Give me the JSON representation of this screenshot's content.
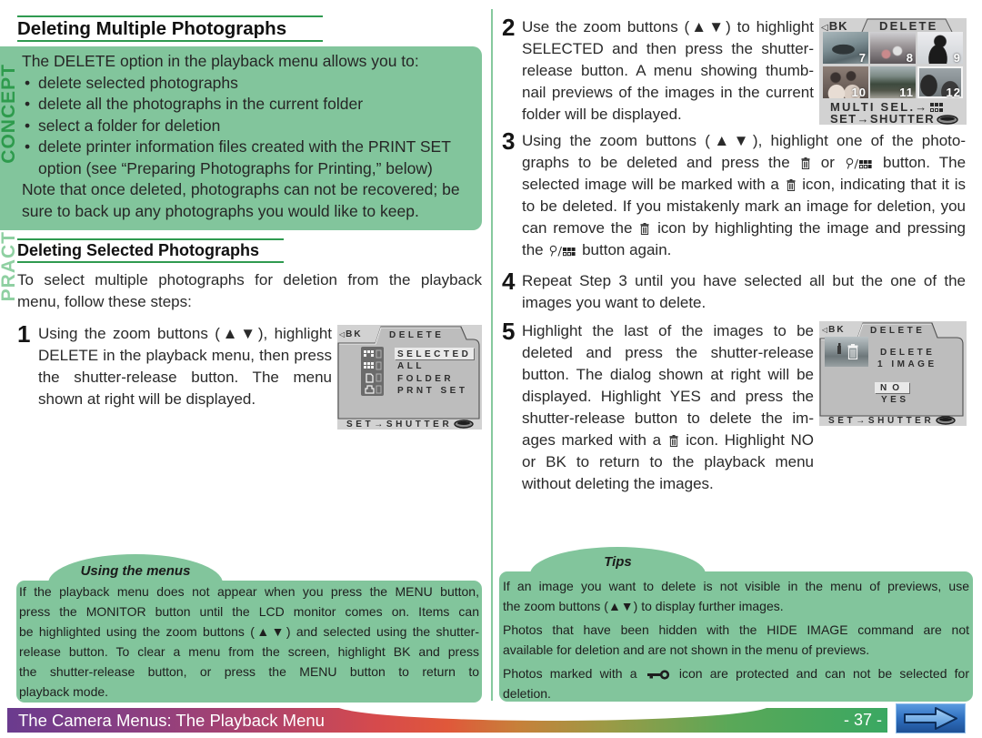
{
  "colors": {
    "accent": "#2f9a50",
    "callout_bg": "#82c59c",
    "label_concept": "#2e9b4d",
    "label_practice": "#8fd0a2"
  },
  "icons": {
    "trash": "trash-icon",
    "zoom-thumb": "zoom-thumbnail-icon",
    "key": "protect-key-icon",
    "shutter": "shutter-button-icon",
    "back": "back-arrow-icon",
    "grid": "thumbnail-grid-icon"
  },
  "side_labels": {
    "concept": "CONCEPT",
    "practice": "PRACT"
  },
  "headings": {
    "main": "Deleting Multiple Photographs",
    "selected": "Deleting Selected Photographs"
  },
  "concept": {
    "intro": "The DELETE option in the playback menu allows you to:",
    "bullet_char": "•",
    "bullets": [
      [
        "delete selected photographs"
      ],
      [
        "delete all the photographs in the current folder"
      ],
      [
        "select a folder for deletion"
      ],
      [
        "delete printer information files created with the PRINT SET",
        "option (see “Preparing Photographs for Printing,” below)"
      ]
    ],
    "note": [
      "Note that once deleted, photographs can not be recovered; be",
      "sure to back up any photographs you would like to keep."
    ]
  },
  "intro": [
    "To select multiple photographs for deletion from the playback",
    "menu, follow these steps:"
  ],
  "steps": [
    {
      "number": "1",
      "lines": [
        "Using the zoom buttons (▲▼), highlight",
        "DELETE in the playback menu, then press",
        "the shutter-release button.  The menu",
        "shown at right will be displayed."
      ]
    },
    {
      "number": "2",
      "lines": [
        "Use the zoom buttons (▲▼) to highlight",
        "SELECTED and then press the shutter-",
        "release button.  A menu showing thumb-",
        "nail previews of the images in the current",
        "folder will be displayed."
      ]
    },
    {
      "number": "3",
      "lines": [
        "Using the zoom buttons (▲▼), highlight one of the photo-",
        "graphs to be deleted and press the {trash} or {zoom-thumb} button.  The",
        "selected image will be marked with a {trash} icon, indicating that it is",
        "to be deleted.  If you mistakenly mark an image for deletion, you",
        "can remove the {trash} icon by highlighting the image and pressing",
        "the {zoom-thumb} button again."
      ]
    },
    {
      "number": "4",
      "lines": [
        "Repeat Step 3 until you have selected all but the one of the",
        "images you want to delete."
      ]
    },
    {
      "number": "5",
      "lines": [
        "Highlight the last of the images to be",
        "deleted and press the shutter-release",
        "button.  The dialog shown at right will be",
        "displayed.  Highlight YES and press the",
        "shutter-release button to delete the im-",
        "ages marked with a {trash} icon.  Highlight NO",
        "or BK to return to the playback menu",
        "without deleting the images."
      ]
    }
  ],
  "screens": {
    "delete_menu": {
      "back": "BK",
      "title": "DELETE",
      "options": [
        "SELECTED",
        "ALL",
        "FOLDER",
        "PRNT SET"
      ],
      "selected_index": 0,
      "footer": "SET→SHUTTER"
    },
    "thumbnail_menu": {
      "back": "BK",
      "title": "DELETE",
      "thumbnails": [
        "7",
        "8",
        "9",
        "10",
        "11",
        "12"
      ],
      "highlighted_index": 5,
      "footer_lines": [
        "MULTI SEL.→",
        "SET→SHUTTER"
      ]
    },
    "confirm_dialog": {
      "back": "BK",
      "title": "DELETE",
      "message": [
        "DELETE",
        "1 IMAGE"
      ],
      "options": [
        "NO",
        "YES"
      ],
      "selected_index": 0,
      "footer": "SET→SHUTTER"
    }
  },
  "callouts": {
    "using_menus": {
      "title": "Using the menus",
      "lines": [
        "If the playback menu does not appear when you press the MENU button,",
        "press the MONITOR button until the LCD monitor comes on.  Items can",
        "be highlighted using the zoom buttons (▲▼) and selected using the shutter-",
        "release button.  To clear a menu from the screen, highlight BK and press",
        "the shutter-release button, or press the MENU button to return to",
        "playback mode."
      ]
    },
    "tips": {
      "title": "Tips",
      "paragraphs": [
        [
          "If an image you want to delete is not visible in the menu of previews, use",
          "the zoom buttons (▲▼) to display further images."
        ],
        [
          "Photos that have been hidden with the HIDE IMAGE command are not",
          "available for deletion and are not shown in the menu of previews."
        ],
        [
          "Photos marked with a {key} icon are protected and can not be selected for",
          "deletion."
        ]
      ]
    }
  },
  "footer": {
    "section_title": "The Camera Menus: The Playback Menu",
    "page_number": "- 37 -",
    "next_button_icon": "right-arrow-icon"
  }
}
